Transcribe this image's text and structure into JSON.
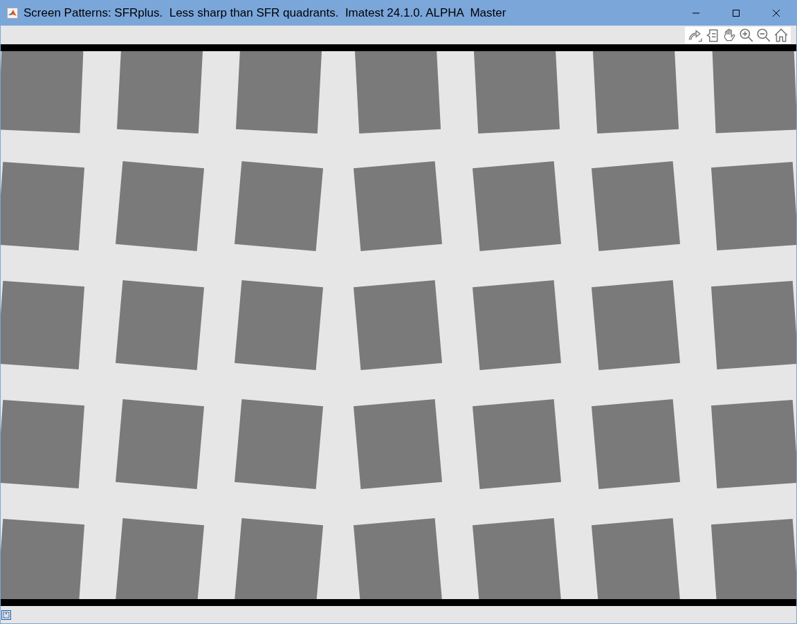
{
  "window": {
    "title": "Screen Patterns: SFRplus.  Less sharp than SFR quadrants.  Imatest 24.1.0. ALPHA  Master"
  }
}
